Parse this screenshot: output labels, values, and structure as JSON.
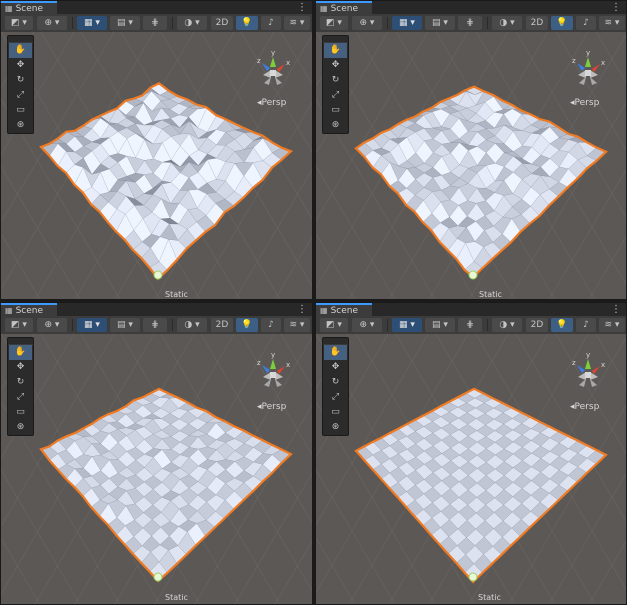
{
  "tab_icon": "hash-grid-icon",
  "views": [
    {
      "tab": "Scene",
      "persp": "Persp",
      "static": "Static",
      "toggle_2d": "2D",
      "terrain": "heavy-noise"
    },
    {
      "tab": "Scene",
      "persp": "Persp",
      "static": "Static",
      "toggle_2d": "2D",
      "terrain": "medium-noise"
    },
    {
      "tab": "Scene",
      "persp": "Persp",
      "static": "Static",
      "toggle_2d": "2D",
      "terrain": "light-noise"
    },
    {
      "tab": "Scene",
      "persp": "Persp",
      "static": "Static",
      "toggle_2d": "2D",
      "terrain": "flat"
    }
  ],
  "gizmo": {
    "y": "y",
    "x": "x",
    "z": "z"
  },
  "tools": [
    "hand-tool",
    "move-tool",
    "rotate-tool",
    "scale-tool",
    "rect-tool",
    "transform-tool"
  ],
  "colors": {
    "selection_outline": "#f07a22",
    "tab_accent": "#3d9bff",
    "viewport_bg": "#5c5855",
    "toolbar_bg": "#3c3c3c",
    "active_button": "#2e4f75"
  }
}
